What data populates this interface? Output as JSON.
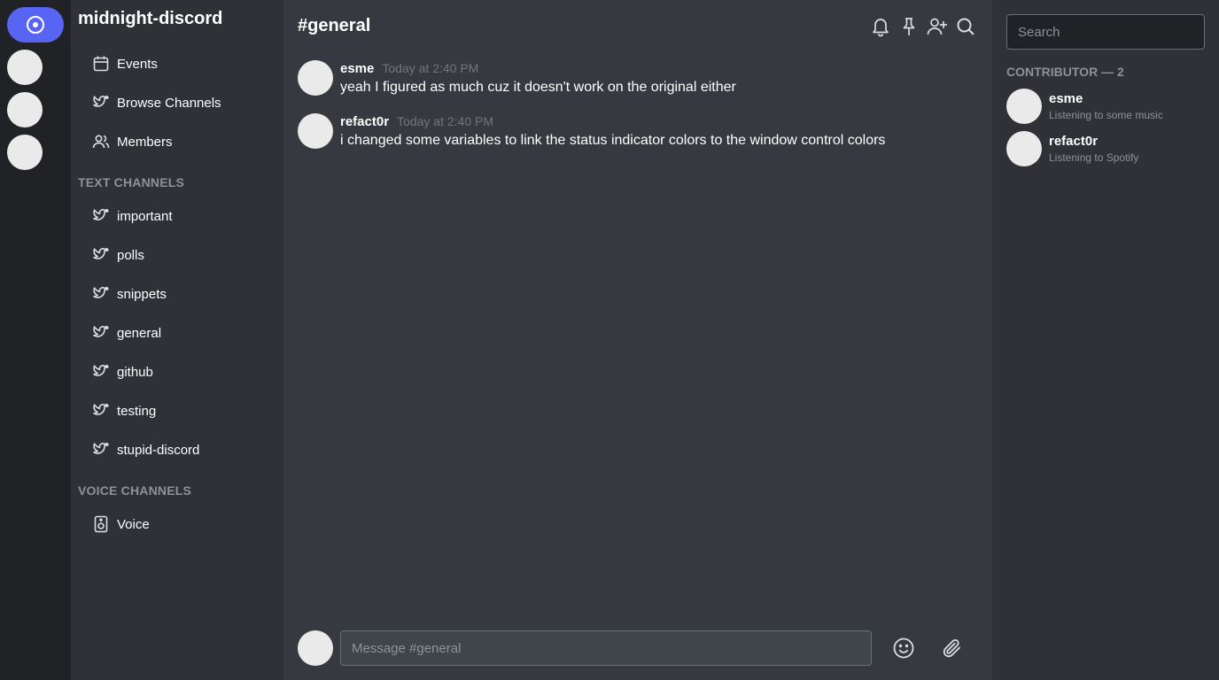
{
  "colors": {
    "accent": "#5865f2",
    "rail_bg": "#202225",
    "sidebar_bg": "#2f3136",
    "main_bg": "#36393f",
    "avatar_placeholder": "#eaeaea"
  },
  "server": {
    "name": "midnight-discord"
  },
  "nav": [
    {
      "label": "Events",
      "icon": "calendar-icon"
    },
    {
      "label": "Browse Channels",
      "icon": "bird-icon"
    },
    {
      "label": "Members",
      "icon": "users-icon"
    }
  ],
  "text_channels": {
    "label": "TEXT CHANNELS",
    "items": [
      "important",
      "polls",
      "snippets",
      "general",
      "github",
      "testing",
      "stupid-discord"
    ]
  },
  "voice_channels": {
    "label": "VOICE CHANNELS",
    "items": [
      "Voice"
    ]
  },
  "channel": {
    "title": "#general"
  },
  "toolbar": [
    "bell-icon",
    "pin-icon",
    "add-user-icon",
    "search-icon"
  ],
  "messages": [
    {
      "author": "esme",
      "time": "Today at 2:40 PM",
      "text": "yeah I figured as much cuz it doesn't work on the original either"
    },
    {
      "author": "refact0r",
      "time": "Today at 2:40 PM",
      "text": "i changed some variables to link the status indicator colors to the window control colors"
    }
  ],
  "composer": {
    "placeholder": "Message #general"
  },
  "members_panel": {
    "search_placeholder": "Search",
    "role_label": "CONTRIBUTOR — 2",
    "members": [
      {
        "name": "esme",
        "status": "Listening to some music"
      },
      {
        "name": "refact0r",
        "status": "Listening to Spotify"
      }
    ]
  }
}
